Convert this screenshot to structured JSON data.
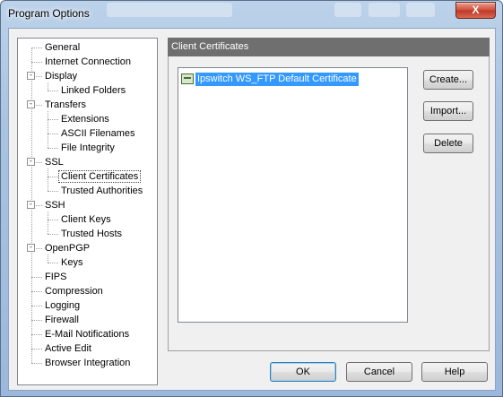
{
  "window": {
    "title": "Program Options",
    "close_label": "X"
  },
  "tree": {
    "items": [
      {
        "label": "General",
        "level": 0
      },
      {
        "label": "Internet Connection",
        "level": 0
      },
      {
        "label": "Display",
        "level": 0,
        "expander": "-"
      },
      {
        "label": "Linked Folders",
        "level": 1
      },
      {
        "label": "Transfers",
        "level": 0,
        "expander": "-"
      },
      {
        "label": "Extensions",
        "level": 1
      },
      {
        "label": "ASCII Filenames",
        "level": 1
      },
      {
        "label": "File Integrity",
        "level": 1
      },
      {
        "label": "SSL",
        "level": 0,
        "expander": "-"
      },
      {
        "label": "Client Certificates",
        "level": 1,
        "selected": true
      },
      {
        "label": "Trusted Authorities",
        "level": 1
      },
      {
        "label": "SSH",
        "level": 0,
        "expander": "-"
      },
      {
        "label": "Client Keys",
        "level": 1
      },
      {
        "label": "Trusted Hosts",
        "level": 1
      },
      {
        "label": "OpenPGP",
        "level": 0,
        "expander": "-"
      },
      {
        "label": "Keys",
        "level": 1
      },
      {
        "label": "FIPS",
        "level": 0
      },
      {
        "label": "Compression",
        "level": 0
      },
      {
        "label": "Logging",
        "level": 0
      },
      {
        "label": "Firewall",
        "level": 0
      },
      {
        "label": "E-Mail Notifications",
        "level": 0
      },
      {
        "label": "Active Edit",
        "level": 0
      },
      {
        "label": "Browser Integration",
        "level": 0
      }
    ]
  },
  "panel": {
    "title": "Client Certificates",
    "certificates": [
      {
        "label": "Ipswitch WS_FTP Default Certificate",
        "selected": true
      }
    ],
    "create_label": "Create...",
    "import_label": "Import...",
    "delete_label": "Delete"
  },
  "footer": {
    "ok_label": "OK",
    "cancel_label": "Cancel",
    "help_label": "Help"
  }
}
